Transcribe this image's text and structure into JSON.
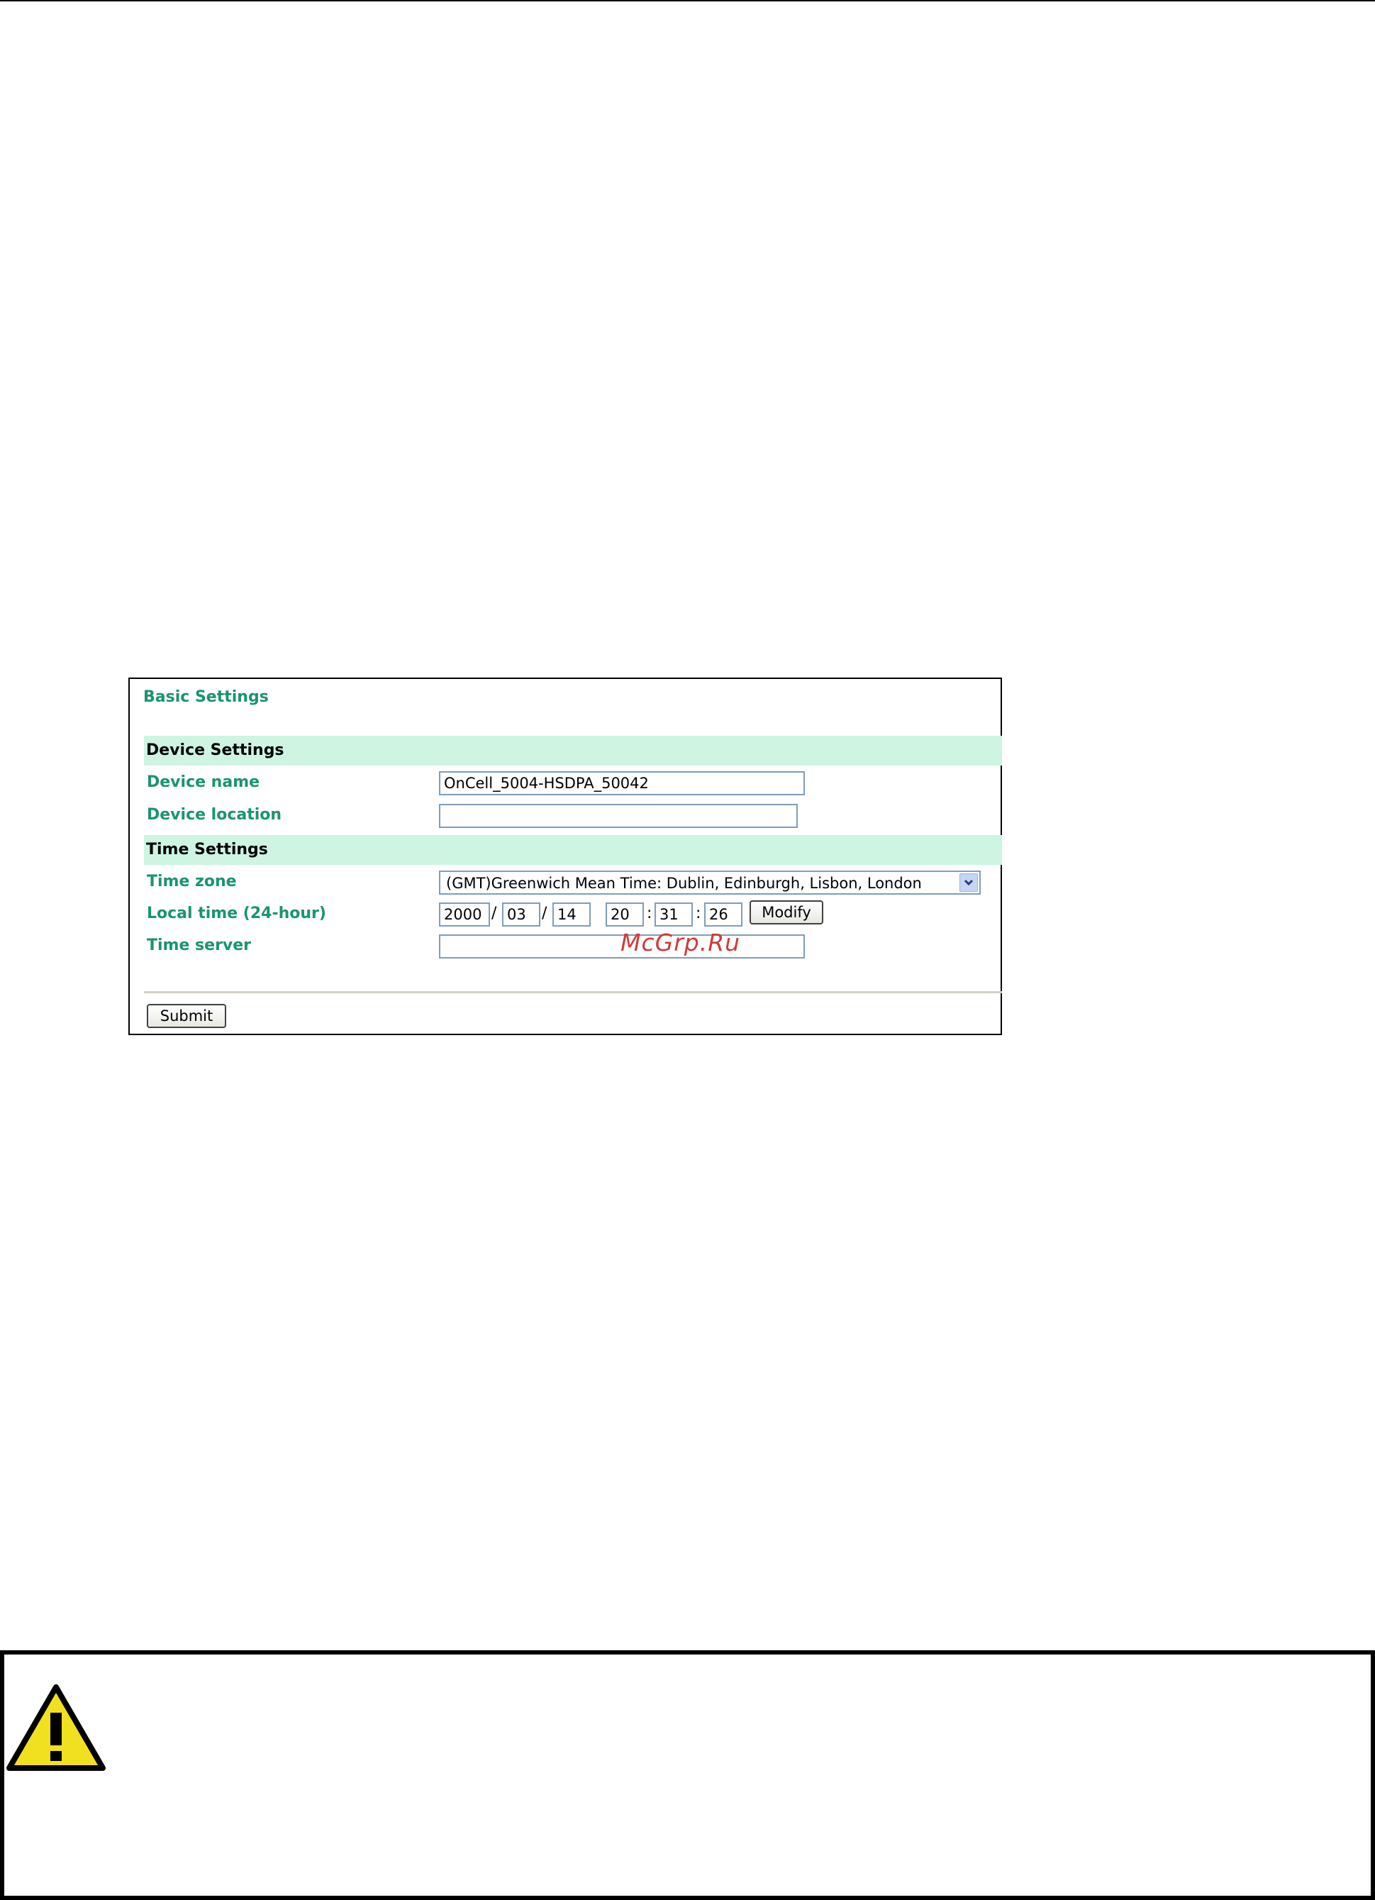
{
  "panel": {
    "title": "Basic Settings",
    "device_section": {
      "heading": "Device Settings",
      "device_name_label": "Device name",
      "device_name_value": "OnCell_5004-HSDPA_50042",
      "device_location_label": "Device location",
      "device_location_value": ""
    },
    "time_section": {
      "heading": "Time Settings",
      "time_zone_label": "Time zone",
      "time_zone_value": "(GMT)Greenwich Mean Time: Dublin, Edinburgh, Lisbon, London",
      "local_time_label": "Local time (24-hour)",
      "local_time": {
        "year": "2000",
        "month": "03",
        "day": "14",
        "hour": "20",
        "minute": "31",
        "second": "26",
        "date_separator": "/",
        "time_separator": ":"
      },
      "modify_label": "Modify",
      "time_server_label": "Time server",
      "time_server_value": ""
    },
    "submit_label": "Submit",
    "watermark": "McGrp.Ru"
  },
  "attention": {
    "icon": "warning-triangle-icon",
    "icon_color": "#f0e020"
  },
  "colors": {
    "label_green": "#1a9470",
    "section_bg": "#cdf5e2",
    "input_border": "#7f9db9",
    "watermark_red": "#d13a3a"
  }
}
